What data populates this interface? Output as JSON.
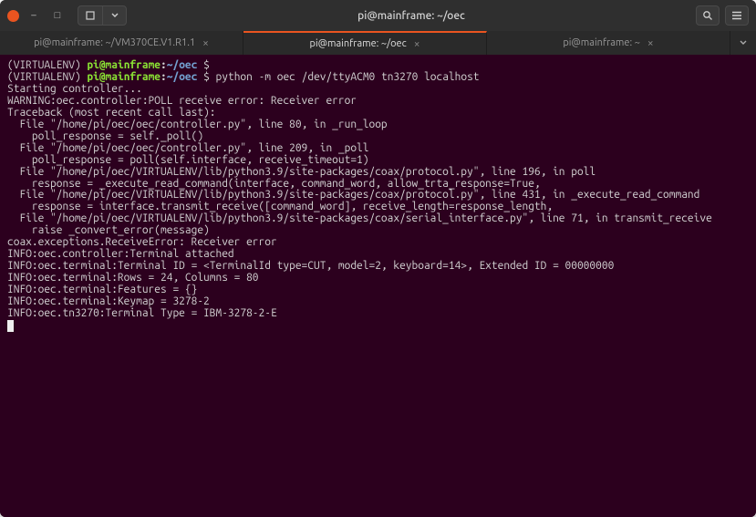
{
  "window": {
    "title": "pi@mainframe: ~/oec"
  },
  "tabs": {
    "items": [
      {
        "label": "pi@mainframe: ~/VM370CE.V1.R1.1",
        "active": false
      },
      {
        "label": "pi@mainframe: ~/oec",
        "active": true
      },
      {
        "label": "pi@mainframe: ~",
        "active": false
      }
    ]
  },
  "prompt": {
    "env_open": "(",
    "env": "VIRTUALENV",
    "env_close": ") ",
    "user_host": "pi@mainframe",
    "colon": ":",
    "path": "~/oec",
    "dollar": " $ "
  },
  "lines": [
    {
      "type": "prompt",
      "cmd": ""
    },
    {
      "type": "prompt",
      "cmd": "python -m oec /dev/ttyACM0 tn3270 localhost"
    },
    {
      "type": "body",
      "text": "Starting controller..."
    },
    {
      "type": "body",
      "text": "WARNING:oec.controller:POLL receive error: Receiver error"
    },
    {
      "type": "body",
      "text": "Traceback (most recent call last):"
    },
    {
      "type": "body",
      "text": "  File \"/home/pi/oec/oec/controller.py\", line 80, in _run_loop"
    },
    {
      "type": "body",
      "text": "    poll_response = self._poll()"
    },
    {
      "type": "body",
      "text": "  File \"/home/pi/oec/oec/controller.py\", line 209, in _poll"
    },
    {
      "type": "body",
      "text": "    poll_response = poll(self.interface, receive_timeout=1)"
    },
    {
      "type": "body",
      "text": "  File \"/home/pi/oec/VIRTUALENV/lib/python3.9/site-packages/coax/protocol.py\", line 196, in poll"
    },
    {
      "type": "body",
      "text": "    response = _execute_read_command(interface, command_word, allow_trta_response=True,"
    },
    {
      "type": "body",
      "text": "  File \"/home/pi/oec/VIRTUALENV/lib/python3.9/site-packages/coax/protocol.py\", line 431, in _execute_read_command"
    },
    {
      "type": "body",
      "text": "    response = interface.transmit_receive([command_word], receive_length=response_length,"
    },
    {
      "type": "body",
      "text": "  File \"/home/pi/oec/VIRTUALENV/lib/python3.9/site-packages/coax/serial_interface.py\", line 71, in transmit_receive"
    },
    {
      "type": "body",
      "text": "    raise _convert_error(message)"
    },
    {
      "type": "body",
      "text": "coax.exceptions.ReceiveError: Receiver error"
    },
    {
      "type": "body",
      "text": "INFO:oec.controller:Terminal attached"
    },
    {
      "type": "body",
      "text": "INFO:oec.terminal:Terminal ID = <TerminalId type=CUT, model=2, keyboard=14>, Extended ID = 00000000"
    },
    {
      "type": "body",
      "text": "INFO:oec.terminal:Rows = 24, Columns = 80"
    },
    {
      "type": "body",
      "text": "INFO:oec.terminal:Features = {}"
    },
    {
      "type": "body",
      "text": "INFO:oec.terminal:Keymap = 3278-2"
    },
    {
      "type": "body",
      "text": "INFO:oec.tn3270:Terminal Type = IBM-3278-2-E"
    }
  ]
}
